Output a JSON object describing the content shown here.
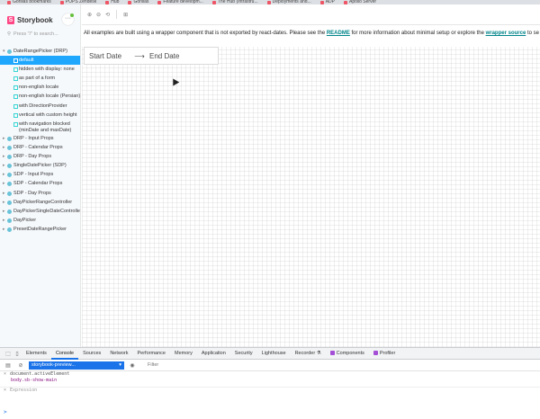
{
  "bookmarks": [
    "Gorillas bookmarks",
    "POPS Zendesk",
    "Hub",
    "Gorillas",
    "Feature developm...",
    "The Hub (Intrastru...",
    "Deployments and...",
    "ADP",
    "Apollo Server"
  ],
  "sidebar": {
    "brand": "Storybook",
    "menu_glyph": "···",
    "search_placeholder": "Press \"/\" to search...",
    "group": {
      "label": "DateRangePicker (DRP)",
      "stories": [
        {
          "label": "default",
          "selected": true
        },
        {
          "label": "hidden with display: none"
        },
        {
          "label": "as part of a form"
        },
        {
          "label": "non-english locale"
        },
        {
          "label": "non-english locale (Persian)"
        },
        {
          "label": "with DirectionProvider"
        },
        {
          "label": "vertical with custom height"
        },
        {
          "label": "with navigation blocked (minDate and maxDate)"
        }
      ]
    },
    "components": [
      "DRP - Input Props",
      "DRP - Calendar Props",
      "DRP - Day Props",
      "SingleDatePicker (SDP)",
      "SDP - Input Props",
      "SDP - Calendar Props",
      "SDP - Day Props",
      "DayPickerRangeController",
      "DayPickerSingleDateController",
      "DayPicker",
      "PresetDateRangePicker"
    ]
  },
  "toolbar": {
    "zoom_in": "⊕",
    "zoom_out": "⊖",
    "zoom_reset": "⟲",
    "grid": "⊞"
  },
  "notice": {
    "prefix": "All examples are built using a wrapper component that is not exported by react-dates. Please see the",
    "readme": "README",
    "middle": "for more information about minimal setup or explore the",
    "wrapper": "wrapper source",
    "suffix": "to se"
  },
  "daterange": {
    "start": "Start Date",
    "arrow": "⟶",
    "end": "End Date"
  },
  "devtools": {
    "tabs": [
      "Elements",
      "Console",
      "Sources",
      "Network",
      "Performance",
      "Memory",
      "Application",
      "Security",
      "Lighthouse",
      "Recorder ⚗",
      "Components",
      "Profiler"
    ],
    "active_tab": "Console",
    "context": "storybook-preview...",
    "filter": "Filter",
    "lines": {
      "expr1": "document.activeElement",
      "result1": "body.sb-show-main",
      "expr2": "Expression"
    },
    "prompt": ">"
  }
}
